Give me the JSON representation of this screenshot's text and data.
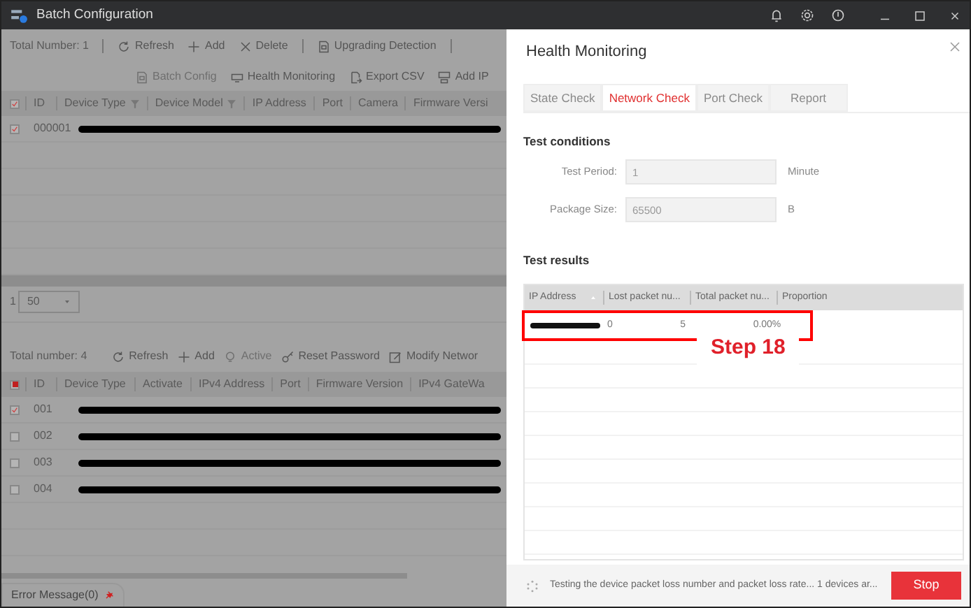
{
  "window": {
    "title": "Batch Configuration"
  },
  "device_list": {
    "total": "Total Number: 1",
    "toolbar": [
      {
        "kind": "separator"
      },
      {
        "kind": "refresh",
        "label": "Refresh",
        "disabled": false
      },
      {
        "kind": "add",
        "label": "Add",
        "disabled": false
      },
      {
        "kind": "delete",
        "label": "Delete",
        "disabled": false
      },
      {
        "kind": "separator"
      },
      {
        "kind": "document",
        "label": "Upgrading Detection",
        "disabled": false
      },
      {
        "kind": "separator"
      }
    ],
    "toolbar2": [
      {
        "kind": "document",
        "label": "Batch Config",
        "disabled": true
      },
      {
        "kind": "monitor",
        "label": "Health Monitoring",
        "disabled": false
      },
      {
        "kind": "export",
        "label": "Export CSV",
        "disabled": false
      },
      {
        "kind": "addip",
        "label": "Add IP",
        "disabled": false
      }
    ],
    "header_checked": true,
    "columns": [
      {
        "label": "ID",
        "filter": false
      },
      {
        "label": "Device Type",
        "filter": true
      },
      {
        "label": "Device Model",
        "filter": true
      },
      {
        "label": "IP Address",
        "filter": false
      },
      {
        "label": "Port",
        "filter": false
      },
      {
        "label": "Camera",
        "filter": false
      },
      {
        "label": "Firmware Versi",
        "filter": false
      }
    ],
    "rows": [
      {
        "id": "000001",
        "checked": true,
        "redacted": true
      }
    ],
    "page": "1",
    "page_size": "50"
  },
  "online_devices": {
    "total": "Total number: 4",
    "toolbar": [
      {
        "kind": "refresh",
        "label": "Refresh",
        "disabled": false
      },
      {
        "kind": "add",
        "label": "Add",
        "disabled": false
      },
      {
        "kind": "bulb",
        "label": "Active",
        "disabled": true
      },
      {
        "kind": "key",
        "label": "Reset Password",
        "disabled": false
      },
      {
        "kind": "edit",
        "label": "Modify Networ",
        "disabled": false
      }
    ],
    "header_checked": false,
    "header_partial": true,
    "columns": [
      {
        "label": "ID",
        "filter": false
      },
      {
        "label": "Device Type",
        "filter": false
      },
      {
        "label": "Activate",
        "filter": false
      },
      {
        "label": "IPv4 Address",
        "filter": false
      },
      {
        "label": "Port",
        "filter": false
      },
      {
        "label": "Firmware Version",
        "filter": false
      },
      {
        "label": "IPv4 GateWa",
        "filter": false
      }
    ],
    "rows": [
      {
        "id": "001",
        "checked": true,
        "redacted": true
      },
      {
        "id": "002",
        "checked": false,
        "redacted": true
      },
      {
        "id": "003",
        "checked": false,
        "redacted": true
      },
      {
        "id": "004",
        "checked": false,
        "redacted": true
      }
    ]
  },
  "error_tab": {
    "label": "Error Message(0)"
  },
  "dialog": {
    "title": "Health Monitoring",
    "tabs": [
      {
        "label": "State Check",
        "selected": false
      },
      {
        "label": "Network Check",
        "selected": true
      },
      {
        "label": "Port Check",
        "selected": false
      },
      {
        "label": "Report",
        "selected": false
      }
    ],
    "conditions_title": "Test conditions",
    "fields": [
      {
        "label": "Test Period:",
        "value": "1",
        "unit": "Minute"
      },
      {
        "label": "Package Size:",
        "value": "65500",
        "unit": "B"
      }
    ],
    "results_title": "Test results",
    "columns": [
      "IP Address",
      "Lost packet nu...",
      "Total packet nu...",
      "Proportion"
    ],
    "rows": [
      {
        "ip_redacted": true,
        "lost": "0",
        "total": "5",
        "proportion": "0.00%",
        "highlighted": true
      }
    ],
    "status": "Testing the device packet loss number and packet loss rate... 1 devices ar...",
    "stop": "Stop"
  },
  "annotation": {
    "label": "Step 18"
  }
}
